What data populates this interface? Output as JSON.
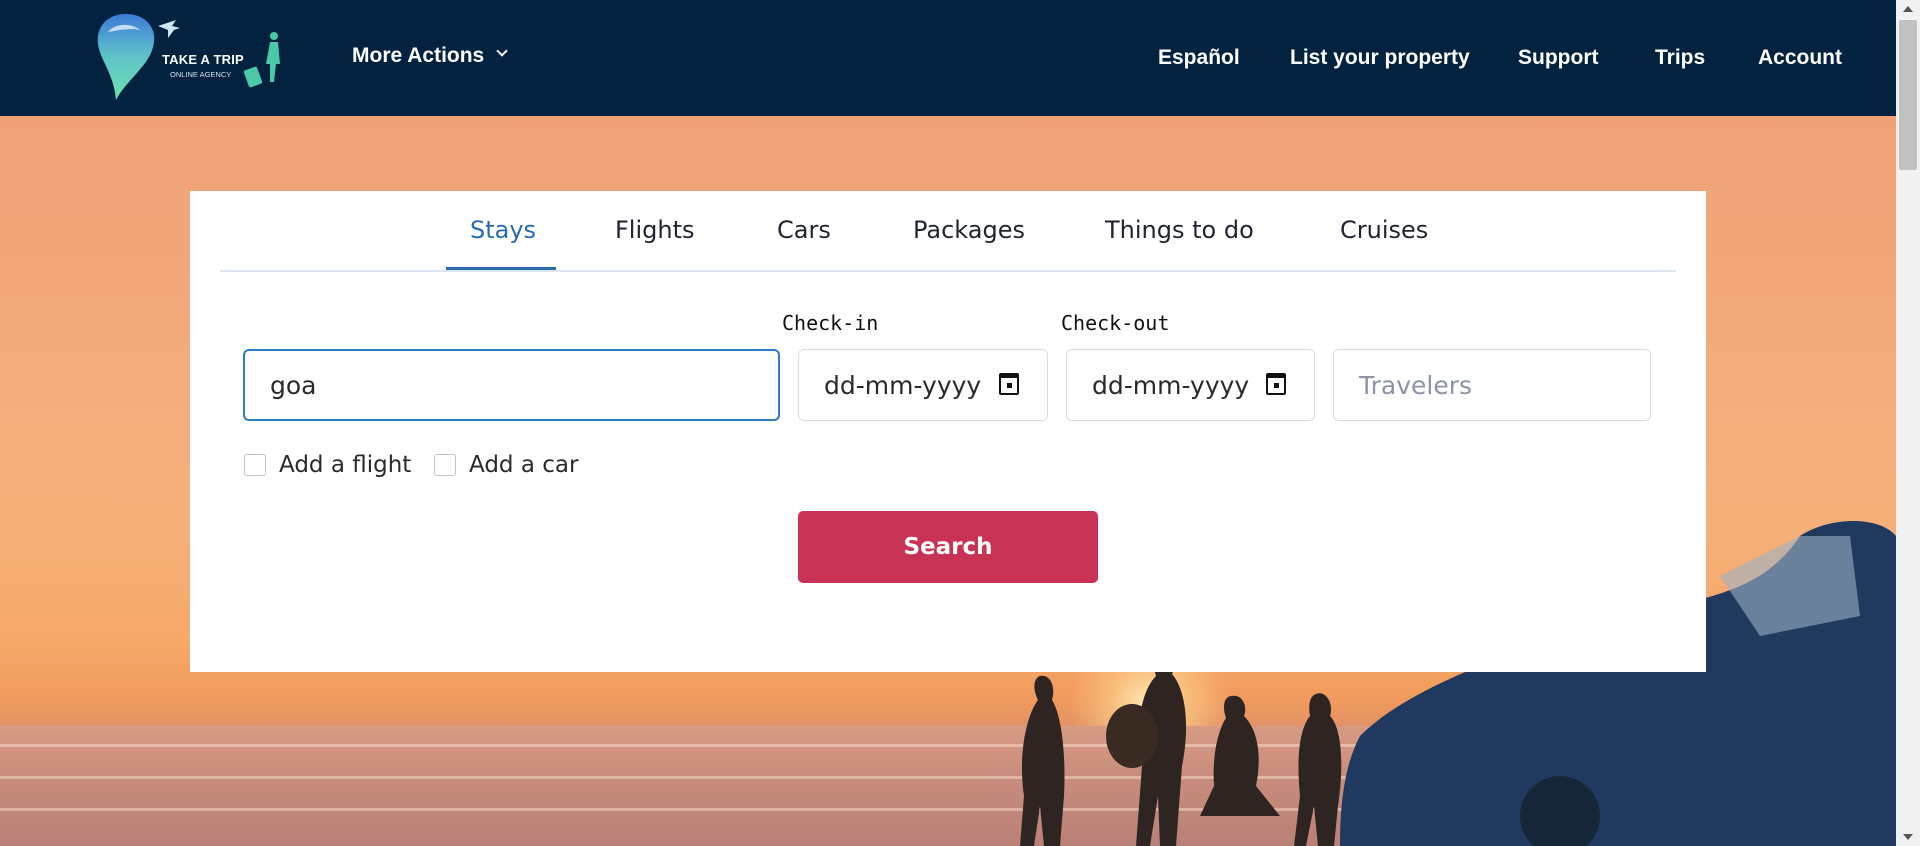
{
  "header": {
    "logo": {
      "brand": "TAKE A TRIP",
      "tagline": "ONLINE AGENCY"
    },
    "more_actions": "More Actions",
    "nav": [
      "Español",
      "List your property",
      "Support",
      "Trips",
      "Account"
    ]
  },
  "search": {
    "tabs": [
      "Stays",
      "Flights",
      "Cars",
      "Packages",
      "Things to do",
      "Cruises"
    ],
    "active_tab": "Stays",
    "destination_value": "goa",
    "checkin_label": "Check-in",
    "checkin_value": "dd-mm-yyyy",
    "checkout_label": "Check-out",
    "checkout_value": "dd-mm-yyyy",
    "travelers_placeholder": "Travelers",
    "add_flight": "Add a flight",
    "add_car": "Add a car",
    "search_button": "Search"
  },
  "colors": {
    "header_bg": "#022240",
    "accent": "#2a6ab0",
    "search_button": "#c83254"
  },
  "icons": [
    "logo-icon",
    "chevron-down-icon",
    "calendar-icon"
  ]
}
